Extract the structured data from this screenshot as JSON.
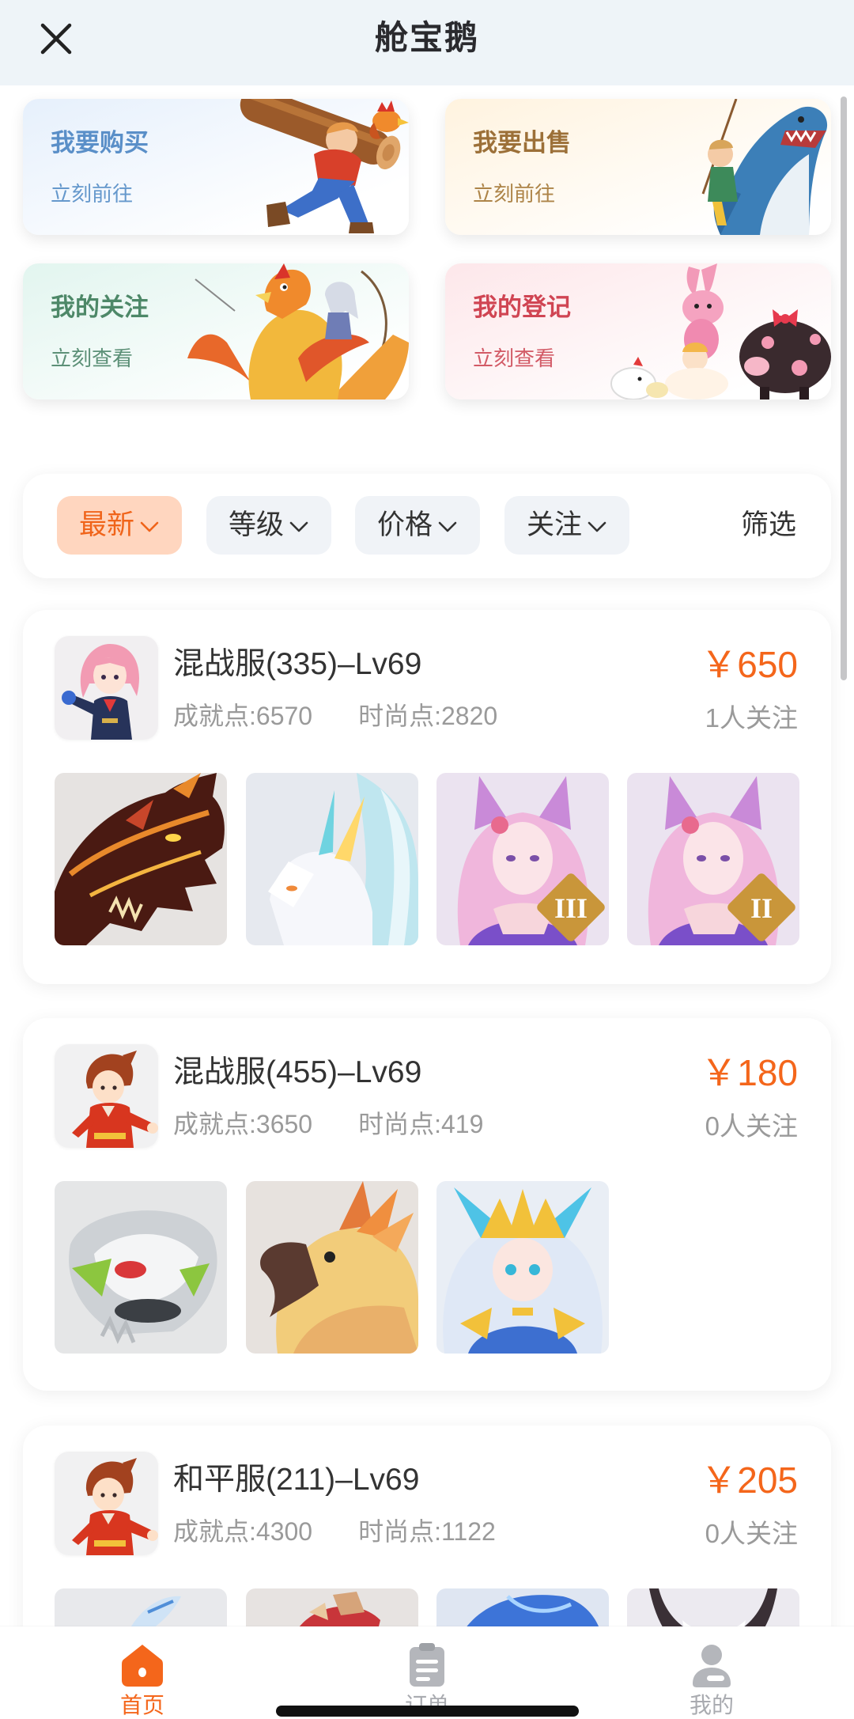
{
  "header": {
    "title": "舱宝鹅",
    "close_icon": "close-icon"
  },
  "entries": [
    {
      "title": "我要购买",
      "subtitle": "立刻前往",
      "title_color": "#5a8fc8",
      "subtitle_color": "#6598cc",
      "illustration": "lumberjack-with-log"
    },
    {
      "title": "我要出售",
      "subtitle": "立刻前往",
      "title_color": "#9c7038",
      "subtitle_color": "#ad8448",
      "illustration": "shark-rider"
    },
    {
      "title": "我的关注",
      "subtitle": "立刻查看",
      "title_color": "#4d8868",
      "subtitle_color": "#5c9077",
      "illustration": "phoenix-archer"
    },
    {
      "title": "我的登记",
      "subtitle": "立刻查看",
      "title_color": "#d04553",
      "subtitle_color": "#d25a66",
      "illustration": "bunny-and-pig"
    }
  ],
  "filters": {
    "items": [
      {
        "label": "最新",
        "active": true
      },
      {
        "label": "等级",
        "active": false
      },
      {
        "label": "价格",
        "active": false
      },
      {
        "label": "关注",
        "active": false
      }
    ],
    "screen_label": "筛选"
  },
  "listings": [
    {
      "title": "混战服(335)–Lv69",
      "achievement": "成就点:6570",
      "fashion": "时尚点:2820",
      "price": "￥650",
      "followers": "1人关注",
      "avatar": "pink-hair-girl-avatar",
      "thumbs": [
        {
          "icon": "dragon-mount-thumb"
        },
        {
          "icon": "white-fox-pet-thumb"
        },
        {
          "icon": "fox-spirit-outfit-thumb",
          "badge": "III"
        },
        {
          "icon": "fox-spirit-outfit-thumb",
          "badge": "II"
        }
      ]
    },
    {
      "title": "混战服(455)–Lv69",
      "achievement": "成就点:3650",
      "fashion": "时尚点:419",
      "price": "￥180",
      "followers": "0人关注",
      "avatar": "red-shirt-boy-avatar",
      "thumbs": [
        {
          "icon": "silver-mask-thumb"
        },
        {
          "icon": "parrot-mount-thumb"
        },
        {
          "icon": "crowned-girl-outfit-thumb"
        }
      ]
    },
    {
      "title": "和平服(211)–Lv69",
      "achievement": "成就点:4300",
      "fashion": "时尚点:1122",
      "price": "￥205",
      "followers": "0人关注",
      "avatar": "red-shirt-boy-avatar",
      "thumbs": [
        {
          "icon": "feather-thumb"
        },
        {
          "icon": "red-creature-thumb"
        },
        {
          "icon": "blue-outfit-thumb"
        },
        {
          "icon": "horned-creature-thumb"
        }
      ]
    }
  ],
  "tabbar": {
    "items": [
      {
        "label": "首页",
        "icon": "home-icon",
        "active": true
      },
      {
        "label": "订单",
        "icon": "order-icon",
        "active": false
      },
      {
        "label": "我的",
        "icon": "user-icon",
        "active": false
      }
    ]
  },
  "colors": {
    "accent": "#f4661b",
    "header_bg": "#eef4f8",
    "muted_text": "#9a9a9a"
  }
}
